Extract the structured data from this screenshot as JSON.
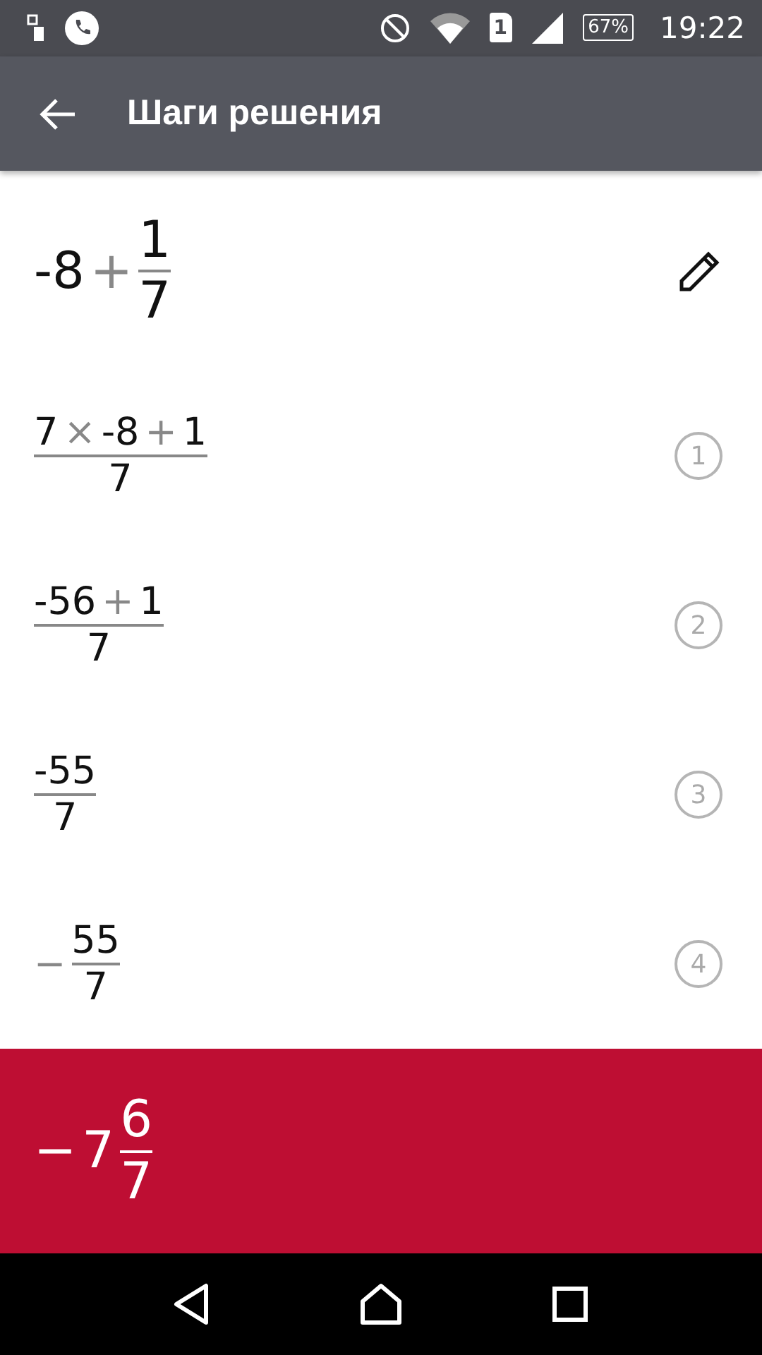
{
  "status_bar": {
    "sim": "1",
    "battery": "67%",
    "time": "19:22"
  },
  "app_bar": {
    "title": "Шаги решения"
  },
  "expression": [
    {
      "kind": "num",
      "text": "-8"
    },
    {
      "kind": "op",
      "text": "+"
    },
    {
      "kind": "frac",
      "num": [
        {
          "kind": "num",
          "text": "1"
        }
      ],
      "den": [
        {
          "kind": "num",
          "text": "7"
        }
      ]
    }
  ],
  "steps": [
    {
      "number": "1",
      "expr": [
        {
          "kind": "frac",
          "num": [
            {
              "kind": "num",
              "text": "7"
            },
            {
              "kind": "op",
              "text": "×"
            },
            {
              "kind": "num",
              "text": "-8"
            },
            {
              "kind": "op",
              "text": "+"
            },
            {
              "kind": "num",
              "text": "1"
            }
          ],
          "den": [
            {
              "kind": "num",
              "text": "7"
            }
          ]
        }
      ]
    },
    {
      "number": "2",
      "expr": [
        {
          "kind": "frac",
          "num": [
            {
              "kind": "num",
              "text": "-56"
            },
            {
              "kind": "op",
              "text": "+"
            },
            {
              "kind": "num",
              "text": "1"
            }
          ],
          "den": [
            {
              "kind": "num",
              "text": "7"
            }
          ]
        }
      ]
    },
    {
      "number": "3",
      "expr": [
        {
          "kind": "frac",
          "num": [
            {
              "kind": "num",
              "text": "-55"
            }
          ],
          "den": [
            {
              "kind": "num",
              "text": "7"
            }
          ]
        }
      ]
    },
    {
      "number": "4",
      "expr": [
        {
          "kind": "op",
          "text": "−"
        },
        {
          "kind": "frac",
          "num": [
            {
              "kind": "num",
              "text": "55"
            }
          ],
          "den": [
            {
              "kind": "num",
              "text": "7"
            }
          ]
        }
      ]
    }
  ],
  "result": [
    {
      "kind": "num",
      "text": "−"
    },
    {
      "kind": "num",
      "text": "7"
    },
    {
      "kind": "frac",
      "num": [
        {
          "kind": "num",
          "text": "6"
        }
      ],
      "den": [
        {
          "kind": "num",
          "text": "7"
        }
      ]
    }
  ]
}
